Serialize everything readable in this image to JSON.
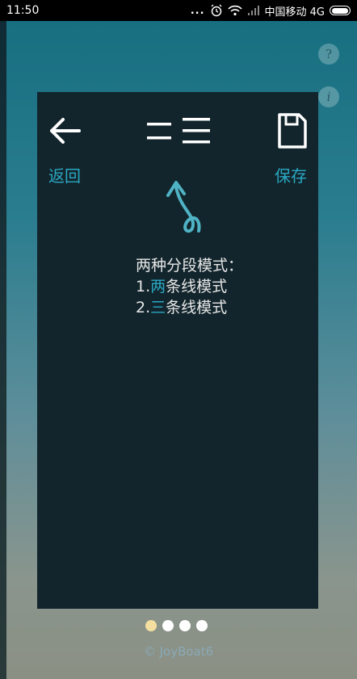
{
  "status_bar": {
    "time": "11:50",
    "dots": "...",
    "carrier": "中国移动 4G",
    "icons": [
      "alarm-icon",
      "wifi-icon",
      "signal-icon",
      "battery-icon"
    ]
  },
  "side_buttons": {
    "help": "?",
    "info": "i"
  },
  "toolbar": {
    "back_label": "返回",
    "save_label": "保存",
    "title_icons": "two-lines-and-three-lines-icon"
  },
  "description": {
    "heading": "两种分段模式：",
    "line1_prefix": "1.",
    "line1_highlight": "两",
    "line1_rest": "条线模式",
    "line2_prefix": "2.",
    "line2_highlight": "三",
    "line2_rest": "条线模式"
  },
  "pager": {
    "total": 4,
    "active_index": 0
  },
  "footer": {
    "copyright": "© JoyBoat6"
  },
  "colors": {
    "accent": "#2aa8c4",
    "panel": "#12252c",
    "active_dot": "#f5dfa0"
  }
}
